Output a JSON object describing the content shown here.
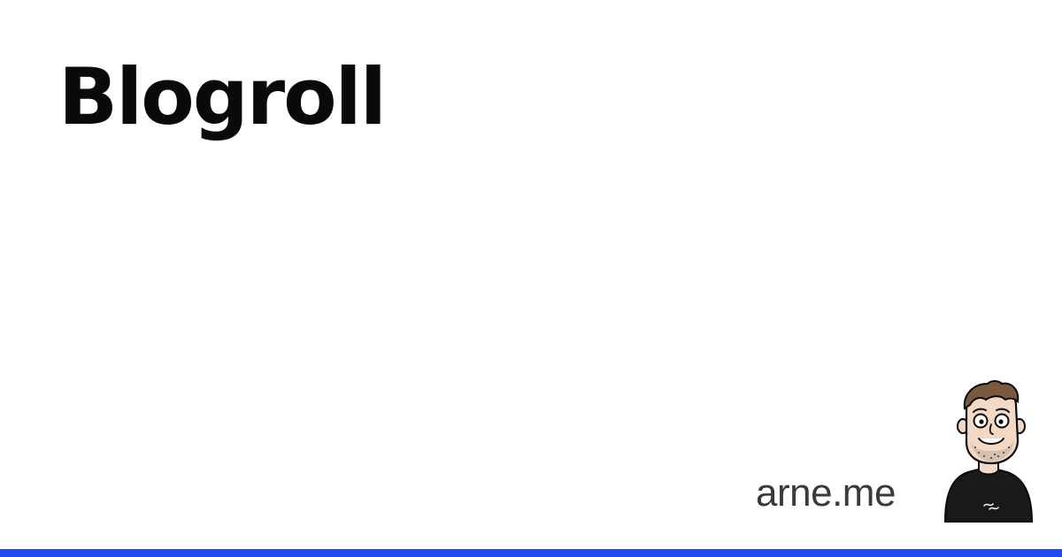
{
  "page": {
    "title": "Blogroll",
    "site_name": "arne.me"
  },
  "avatar": {
    "icon": "cartoon-avatar-icon"
  },
  "colors": {
    "background": "#ffffff",
    "title": "#0a0a0a",
    "site_name": "#3a3a3a",
    "accent_bar": "#1f4cf0"
  }
}
